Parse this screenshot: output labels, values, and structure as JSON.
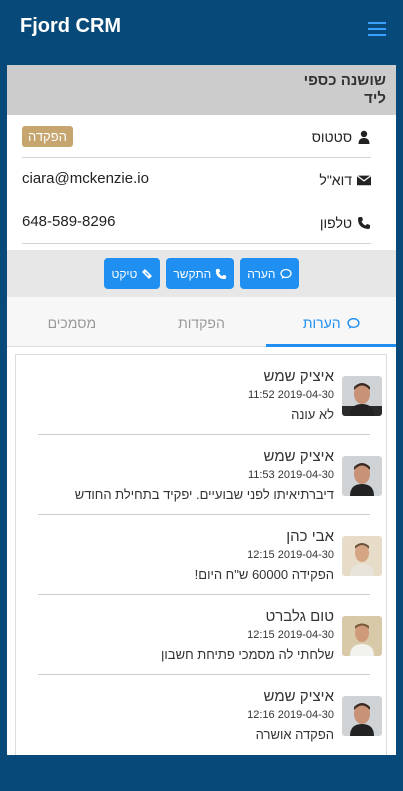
{
  "app": {
    "title": "Fjord CRM"
  },
  "contact": {
    "name": "שושנה כספי",
    "type": "ליד"
  },
  "status": {
    "label": "סטטוס",
    "value": "הפקדה"
  },
  "email": {
    "label": "דוא\"ל",
    "value": "ciara@mckenzie.io"
  },
  "phone": {
    "label": "טלפון",
    "value": "648-589-8296"
  },
  "actions": {
    "note": "הערה",
    "call": "התקשר",
    "ticket": "טיקט"
  },
  "tabs": {
    "notes": "הערות",
    "deposits": "הפקדות",
    "documents": "מסמכים"
  },
  "notes": [
    {
      "author": "איציק שמש",
      "date": "2019-04-30 11:52",
      "text": "לא עונה"
    },
    {
      "author": "איציק שמש",
      "date": "2019-04-30 11:53",
      "text": "דיברתיאיתו לפני שבועיים. יפקיד בתחילת החודש"
    },
    {
      "author": "אבי כהן",
      "date": "2019-04-30 12:15",
      "text": "הפקידה 60000 ש\"ח היום!"
    },
    {
      "author": "טום גלברט",
      "date": "2019-04-30 12:15",
      "text": "שלחתי לה מסמכי פתיחת חשבון"
    },
    {
      "author": "איציק שמש",
      "date": "2019-04-30 12:16",
      "text": "הפקדה אושרה"
    }
  ]
}
